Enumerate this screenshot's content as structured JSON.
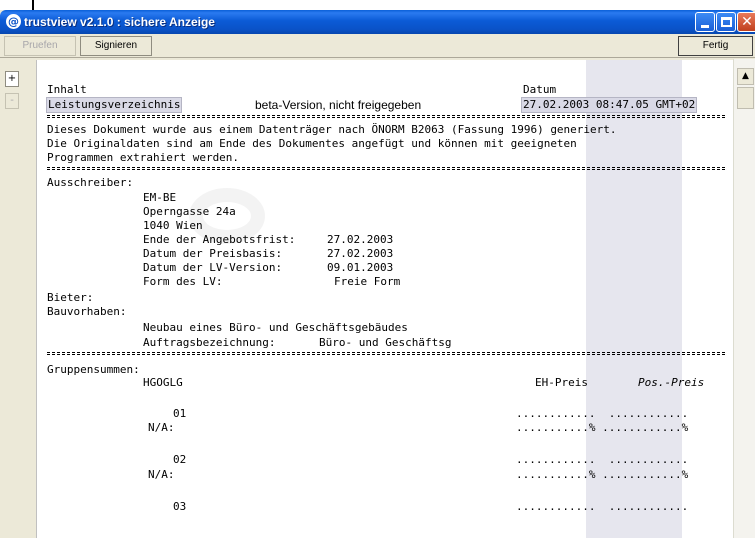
{
  "window": {
    "title": "trustview v2.1.0 : sichere Anzeige",
    "icon": "trustview-logo-icon"
  },
  "toolbar": {
    "pruefen_label": "Pruefen",
    "signieren_label": "Signieren",
    "fertig_label": "Fertig"
  },
  "sidebar": {
    "expand_label": "+",
    "collapse_label": "-"
  },
  "document": {
    "header_inhalt": "Inhalt",
    "header_datum": "Datum",
    "title": "Leistungsverzeichnis",
    "version_note": "beta-Version, nicht freigegeben",
    "datetime": "27.02.2003 08:47.05 GMT+02",
    "intro_1": "Dieses Dokument wurde aus einem Datenträger nach ÖNORM B2063 (Fassung 1996) generiert.",
    "intro_2": "Die Originaldaten sind am Ende des Dokumentes angefügt und können mit geeigneten",
    "intro_3": "Programmen extrahiert werden.",
    "ausschreiber_label": "Ausschreiber:",
    "ausschreiber_name": "EM-BE",
    "ausschreiber_street": "Operngasse 24a",
    "ausschreiber_city": "1040 Wien",
    "angebotsfrist_label": "Ende der Angebotsfrist:",
    "angebotsfrist_value": "27.02.2003",
    "preisbasis_label": "Datum der Preisbasis:",
    "preisbasis_value": "27.02.2003",
    "lv_version_label": "Datum der LV-Version:",
    "lv_version_value": "09.01.2003",
    "form_label": "Form des LV:",
    "form_value": "Freie Form",
    "bieter_label": "Bieter:",
    "bauvorhaben_label": "Bauvorhaben:",
    "bauvorhaben_value": "Neubau eines Büro- und Geschäftsgebäudes",
    "auftrag_label": "Auftragsbezeichnung:",
    "auftrag_value": "Büro- und Geschäftsg",
    "gruppensummen_label": "Gruppensummen:",
    "hgoglg_label": "HGOGLG",
    "eh_preis_label": "EH-Preis",
    "pos_preis_label": "Pos.-Preis"
  },
  "groups": [
    {
      "code": "01",
      "na_label": "N/A:",
      "dots_1": "............  ............",
      "dots_2": "...........% ............%"
    },
    {
      "code": "02",
      "na_label": "N/A:",
      "dots_1": "............  ............",
      "dots_2": "...........% ............%"
    },
    {
      "code": "03",
      "dots_1": "............  ............"
    }
  ]
}
